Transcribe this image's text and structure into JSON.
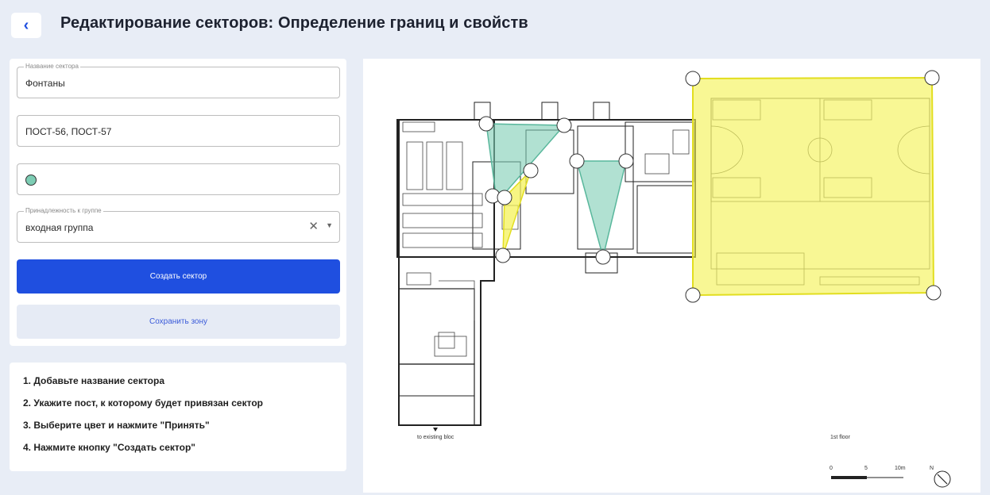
{
  "header": {
    "back_icon": "chevron-left-icon",
    "back_glyph": "‹",
    "title": "Редактирование секторов: Определение границ и свойств"
  },
  "form": {
    "sector_name": {
      "legend": "Название сектора",
      "value": "Фонтаны"
    },
    "posts": {
      "value": "ПОСТ-56, ПОСТ-57"
    },
    "color": {
      "value": "#7dcdb4"
    },
    "group": {
      "legend": "Принадлежность к группе",
      "value": "входная группа",
      "clear_glyph": "✕",
      "chevron_glyph": "▼"
    },
    "create_button": "Создать сектор",
    "save_button": "Сохранить зону"
  },
  "instructions": [
    "1. Добавьте название сектора",
    "2. Укажите пост, к которому будет привязан сектор",
    "3. Выберите цвет и нажмите \"Принять\"",
    "4. Нажмите кнопку \"Создать сектор\""
  ],
  "map": {
    "label_existing": "to existing bloc",
    "label_floor": "1st floor",
    "scale": [
      "0",
      "5",
      "10m"
    ],
    "north": "N",
    "zone_colors": {
      "teal": "#7dcdb4",
      "yellow": "#f4f25a"
    }
  }
}
